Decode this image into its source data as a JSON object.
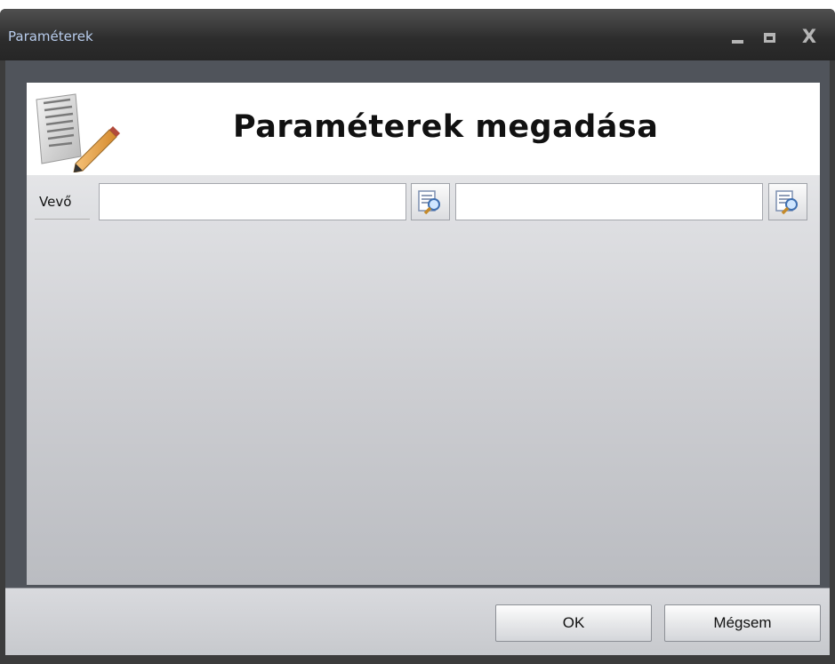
{
  "window": {
    "title": "Paraméterek",
    "controls": {
      "close_label": "X"
    }
  },
  "header": {
    "title": "Paraméterek megadása",
    "icon": "document-edit-icon"
  },
  "form": {
    "field_label": "Vevő",
    "input_from": {
      "value": "",
      "placeholder": ""
    },
    "input_to": {
      "value": "",
      "placeholder": ""
    },
    "lookup_icon": "lookup-search-icon"
  },
  "footer": {
    "ok_label": "OK",
    "cancel_label": "Mégsem"
  },
  "colors": {
    "title_text": "#b8ccec",
    "titlebar": "#2c2c2c",
    "window_frame": "#50545b"
  }
}
